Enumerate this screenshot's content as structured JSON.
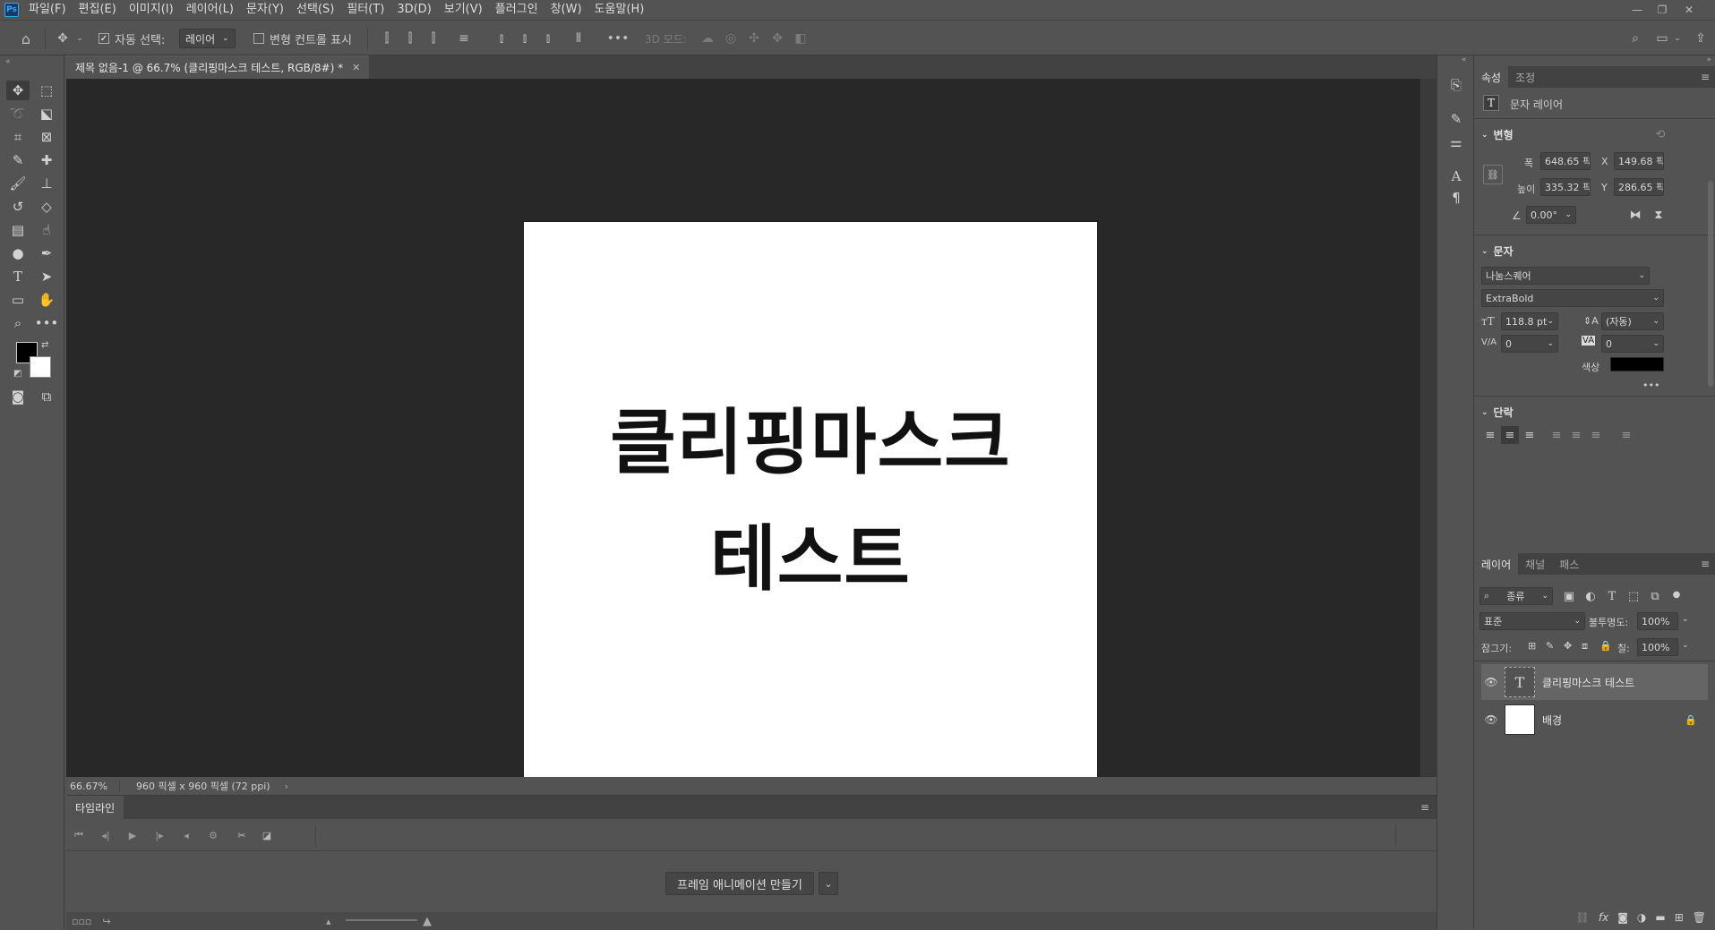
{
  "app": {
    "logo": "Ps"
  },
  "menu": [
    "파일(F)",
    "편집(E)",
    "이미지(I)",
    "레이어(L)",
    "문자(Y)",
    "선택(S)",
    "필터(T)",
    "3D(D)",
    "보기(V)",
    "플러그인",
    "창(W)",
    "도움말(H)"
  ],
  "options": {
    "auto_select_label": "자동 선택:",
    "auto_select_value": "레이어",
    "transform_controls_label": "변형 컨트롤 표시",
    "mode_3d_label": "3D 모드:",
    "more": "•••"
  },
  "document": {
    "tab_title": "제목 없음-1 @ 66.7% (클리핑마스크 테스트, RGB/8#) *",
    "line1": "클리핑마스크",
    "line2": "테스트",
    "zoom": "66.67%",
    "info": "960 픽셀 x 960 픽셀 (72 ppi)"
  },
  "timeline": {
    "tab": "타임라인",
    "create_button": "프레임 애니메이션 만들기"
  },
  "properties": {
    "tabs": [
      "속성",
      "조정"
    ],
    "layer_kind": "문자 레이어",
    "transform": {
      "title": "변형",
      "w_label": "폭",
      "w_value": "648.65 픽셀",
      "h_label": "높이",
      "h_value": "335.32 픽셀",
      "x_label": "X",
      "x_value": "149.68 픽셀",
      "y_label": "Y",
      "y_value": "286.65 픽셀",
      "angle": "0.00°"
    },
    "character": {
      "title": "문자",
      "font": "나눔스퀘어",
      "style": "ExtraBold",
      "size": "118.8 pt",
      "leading": "(자동)",
      "kerning": "0",
      "tracking": "0",
      "color_label": "색상",
      "color": "#000000",
      "more": "•••"
    },
    "paragraph": {
      "title": "단락"
    }
  },
  "layers_panel": {
    "tabs": [
      "레이어",
      "채널",
      "패스"
    ],
    "filter": "종류",
    "blend_mode": "표준",
    "opacity_label": "불투명도:",
    "opacity": "100%",
    "lock_label": "잠그기:",
    "fill_label": "칠:",
    "fill": "100%",
    "layers": [
      {
        "name": "클리핑마스크 테스트",
        "type": "text",
        "selected": true
      },
      {
        "name": "배경",
        "type": "background",
        "selected": false
      }
    ]
  }
}
